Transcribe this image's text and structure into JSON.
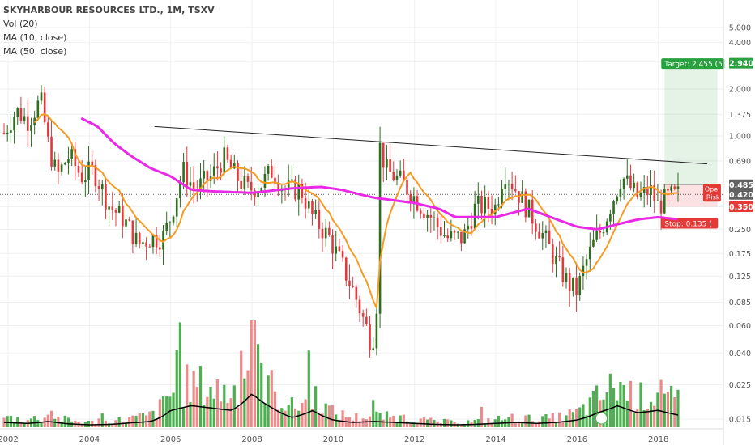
{
  "legend": {
    "title": "SKYHARBOUR RESOURCES LTD., 1M, TSXV",
    "vol": "Vol (20)",
    "ma10": "MA (10, close)",
    "ma50": "MA (50, close)"
  },
  "chart_data": {
    "type": "candlestick",
    "symbol": "SKYHARBOUR RESOURCES LTD.",
    "interval": "1M",
    "exchange": "TSXV",
    "scale": "log",
    "ylim": [
      0.013,
      7.5
    ],
    "xlim": [
      2001.8,
      2019.6
    ],
    "x_ticks": [
      "2002",
      "2004",
      "2006",
      "2008",
      "2010",
      "2012",
      "2014",
      "2016",
      "2018"
    ],
    "y_ticks": [
      7.5,
      5.0,
      4.0,
      3.0,
      2.0,
      1.375,
      1.0,
      0.69,
      0.485,
      0.35,
      0.25,
      0.175,
      0.125,
      0.085,
      0.06,
      0.04,
      0.025,
      0.015
    ],
    "badges": [
      {
        "value": "0.485",
        "color": "#616161"
      },
      {
        "value": "0.420",
        "color": "#616161"
      },
      {
        "value": "0.350",
        "color": "#e53935"
      },
      {
        "value": "2.940",
        "color": "#26a13e"
      }
    ],
    "position_tool": {
      "entry": 0.485,
      "stop": 0.35,
      "target": 2.94,
      "target_label": "Target: 2.455 (5",
      "stop_label": "Stop: 0.135 (",
      "open_label": "Ope",
      "risk_label": "Risk",
      "start_year": 2018.15,
      "end_year": 2019.45
    },
    "trendline": {
      "start": [
        2005.6,
        1.15
      ],
      "end": [
        2019.2,
        0.66
      ]
    },
    "last_price": 0.42,
    "up_color": "#2e6e1e",
    "down_color": "#e0393e",
    "ma10_color": "#f59a23",
    "ma50_color": "#e929e6",
    "vol_ma_color": "#000000",
    "price_anchors": [
      [
        2001.9,
        1.05
      ],
      [
        2002.2,
        1.45
      ],
      [
        2002.5,
        1.25
      ],
      [
        2002.8,
        1.7
      ],
      [
        2003.0,
        0.85
      ],
      [
        2003.2,
        0.55
      ],
      [
        2003.5,
        0.75
      ],
      [
        2003.8,
        0.55
      ],
      [
        2004.1,
        0.6
      ],
      [
        2004.5,
        0.35
      ],
      [
        2004.8,
        0.3
      ],
      [
        2005.0,
        0.25
      ],
      [
        2005.2,
        0.2
      ],
      [
        2005.5,
        0.22
      ],
      [
        2005.8,
        0.22
      ],
      [
        2006.0,
        0.3
      ],
      [
        2006.3,
        0.6
      ],
      [
        2006.6,
        0.45
      ],
      [
        2007.0,
        0.55
      ],
      [
        2007.3,
        0.72
      ],
      [
        2007.6,
        0.55
      ],
      [
        2007.9,
        0.45
      ],
      [
        2008.2,
        0.48
      ],
      [
        2008.5,
        0.6
      ],
      [
        2008.8,
        0.45
      ],
      [
        2009.2,
        0.45
      ],
      [
        2009.5,
        0.3
      ],
      [
        2009.9,
        0.22
      ],
      [
        2010.2,
        0.15
      ],
      [
        2010.5,
        0.1
      ],
      [
        2010.9,
        0.05
      ],
      [
        2011.05,
        0.052
      ],
      [
        2011.15,
        0.85
      ],
      [
        2011.3,
        0.6
      ],
      [
        2011.7,
        0.5
      ],
      [
        2012.0,
        0.4
      ],
      [
        2012.4,
        0.3
      ],
      [
        2012.8,
        0.22
      ],
      [
        2013.2,
        0.22
      ],
      [
        2013.5,
        0.35
      ],
      [
        2014.0,
        0.35
      ],
      [
        2014.2,
        0.6
      ],
      [
        2014.5,
        0.45
      ],
      [
        2014.9,
        0.3
      ],
      [
        2015.2,
        0.22
      ],
      [
        2015.5,
        0.15
      ],
      [
        2015.8,
        0.11
      ],
      [
        2016.0,
        0.1
      ],
      [
        2016.2,
        0.15
      ],
      [
        2016.4,
        0.2
      ],
      [
        2016.6,
        0.25
      ],
      [
        2016.9,
        0.4
      ],
      [
        2017.1,
        0.55
      ],
      [
        2017.5,
        0.4
      ],
      [
        2017.8,
        0.45
      ],
      [
        2018.0,
        0.35
      ],
      [
        2018.2,
        0.4
      ],
      [
        2018.5,
        0.42
      ]
    ],
    "ma50_anchors": [
      [
        2003.8,
        1.3
      ],
      [
        2004.2,
        1.15
      ],
      [
        2004.6,
        0.9
      ],
      [
        2005.0,
        0.75
      ],
      [
        2005.5,
        0.62
      ],
      [
        2006.0,
        0.55
      ],
      [
        2006.5,
        0.45
      ],
      [
        2007.0,
        0.44
      ],
      [
        2008.0,
        0.43
      ],
      [
        2009.0,
        0.46
      ],
      [
        2009.7,
        0.47
      ],
      [
        2010.2,
        0.45
      ],
      [
        2011.0,
        0.4
      ],
      [
        2012.0,
        0.37
      ],
      [
        2012.6,
        0.34
      ],
      [
        2013.0,
        0.3
      ],
      [
        2014.0,
        0.3
      ],
      [
        2014.8,
        0.34
      ],
      [
        2015.5,
        0.29
      ],
      [
        2016.0,
        0.26
      ],
      [
        2016.5,
        0.25
      ],
      [
        2017.0,
        0.27
      ],
      [
        2017.5,
        0.29
      ],
      [
        2018.0,
        0.3
      ],
      [
        2018.5,
        0.29
      ]
    ],
    "volume_anchors": [
      [
        2001.9,
        0.1
      ],
      [
        2002.5,
        0.08
      ],
      [
        2003.0,
        0.12
      ],
      [
        2003.5,
        0.07
      ],
      [
        2004.0,
        0.05
      ],
      [
        2004.5,
        0.06
      ],
      [
        2005.0,
        0.09
      ],
      [
        2005.5,
        0.12
      ],
      [
        2006.0,
        0.35
      ],
      [
        2006.5,
        0.45
      ],
      [
        2007.0,
        0.4
      ],
      [
        2007.5,
        0.35
      ],
      [
        2008.0,
        0.7
      ],
      [
        2008.5,
        0.4
      ],
      [
        2009.0,
        0.2
      ],
      [
        2009.5,
        0.35
      ],
      [
        2010.0,
        0.15
      ],
      [
        2010.5,
        0.1
      ],
      [
        2011.0,
        0.12
      ],
      [
        2011.5,
        0.1
      ],
      [
        2012.0,
        0.08
      ],
      [
        2012.5,
        0.06
      ],
      [
        2013.0,
        0.05
      ],
      [
        2013.5,
        0.06
      ],
      [
        2014.0,
        0.08
      ],
      [
        2014.5,
        0.1
      ],
      [
        2015.0,
        0.08
      ],
      [
        2015.5,
        0.1
      ],
      [
        2016.0,
        0.15
      ],
      [
        2016.5,
        0.3
      ],
      [
        2017.0,
        0.45
      ],
      [
        2017.5,
        0.3
      ],
      [
        2018.0,
        0.35
      ],
      [
        2018.5,
        0.25
      ]
    ]
  }
}
